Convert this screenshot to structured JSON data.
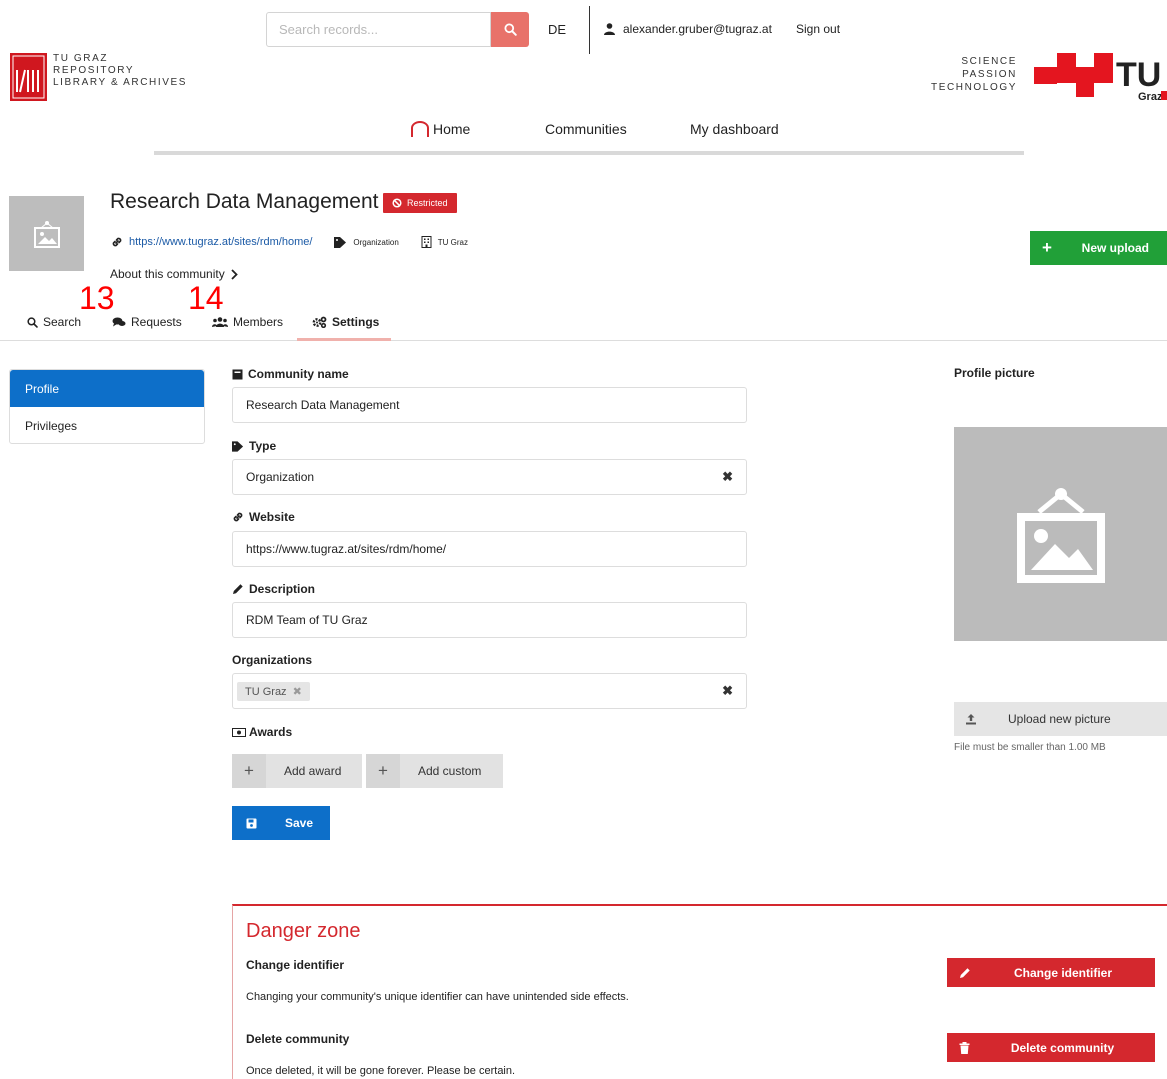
{
  "topbar": {
    "search_placeholder": "Search records...",
    "language": "DE",
    "user_email": "alexander.gruber@tugraz.at",
    "sign_out": "Sign out"
  },
  "logos": {
    "repo_lines": [
      "TU GRAZ",
      "REPOSITORY",
      "LIBRARY & ARCHIVES"
    ],
    "tug_lines": [
      "SCIENCE",
      "PASSION",
      "TECHNOLOGY"
    ],
    "tug_wordmark": "TU Graz"
  },
  "nav": {
    "home": "Home",
    "communities": "Communities",
    "dashboard": "My dashboard"
  },
  "community": {
    "title": "Research Data Management",
    "badge": "Restricted",
    "url": "https://www.tugraz.at/sites/rdm/home/",
    "type": "Organization",
    "org": "TU Graz",
    "about": "About this community",
    "new_upload": "New upload"
  },
  "tabs": {
    "search": "Search",
    "requests": "Requests",
    "members": "Members",
    "settings": "Settings"
  },
  "annotations": {
    "a13": "13",
    "a14": "14"
  },
  "sidemenu": {
    "profile": "Profile",
    "privileges": "Privileges"
  },
  "form": {
    "name_label": "Community name",
    "name_value": "Research Data Management",
    "type_label": "Type",
    "type_value": "Organization",
    "website_label": "Website",
    "website_value": "https://www.tugraz.at/sites/rdm/home/",
    "description_label": "Description",
    "description_value": "RDM Team of TU Graz",
    "orgs_label": "Organizations",
    "org_chip": "TU Graz",
    "awards_label": "Awards",
    "add_award": "Add award",
    "add_custom": "Add custom",
    "save": "Save"
  },
  "profile_picture": {
    "label": "Profile picture",
    "upload": "Upload new picture",
    "hint": "File must be smaller than 1.00 MB"
  },
  "danger": {
    "title": "Danger zone",
    "change_id_title": "Change identifier",
    "change_id_desc": "Changing your community's unique identifier can have unintended side effects.",
    "change_id_btn": "Change identifier",
    "delete_title": "Delete community",
    "delete_desc": "Once deleted, it will be gone forever. Please be certain.",
    "delete_btn": "Delete community"
  },
  "colors": {
    "brand_red": "#d4282e",
    "primary_blue": "#0d6fc9",
    "upload_green": "#21a038",
    "search_button": "#e8726a"
  }
}
